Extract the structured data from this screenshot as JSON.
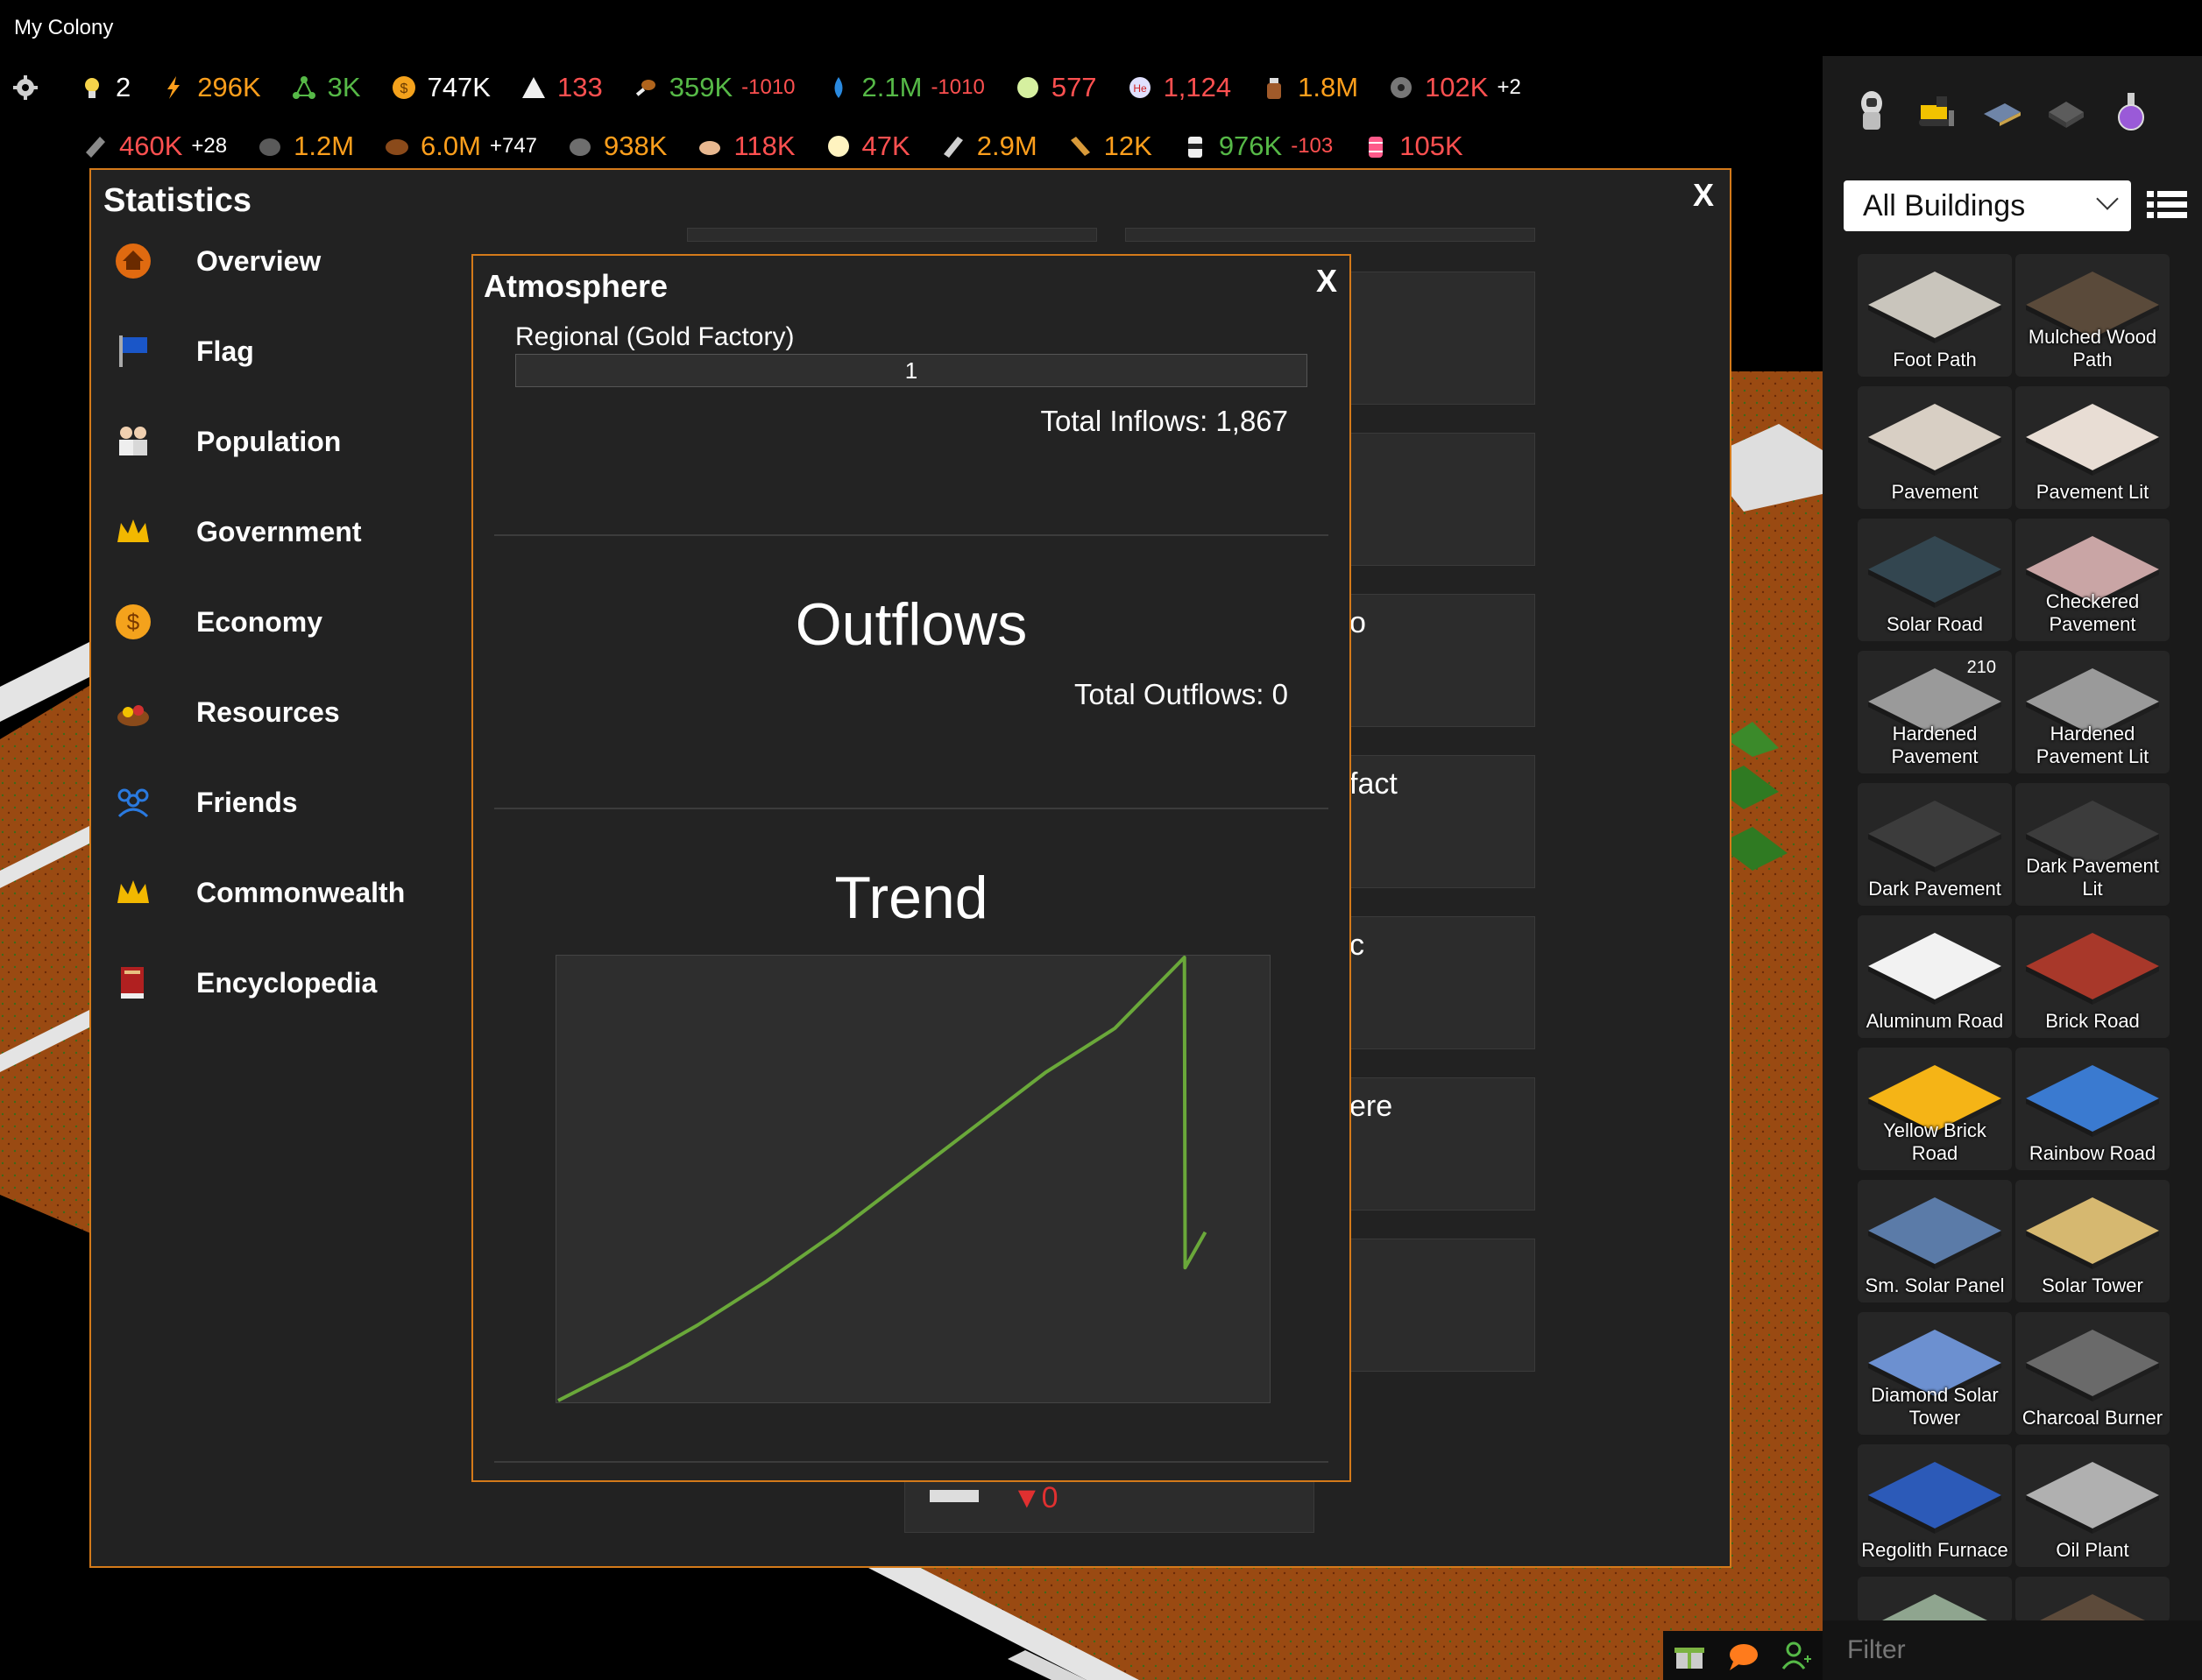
{
  "window_title": "My Colony",
  "resources_row1": [
    {
      "icon": "gear-icon",
      "value": "",
      "delta": "",
      "color": "white"
    },
    {
      "icon": "lightbulb-icon",
      "value": "2",
      "delta": "",
      "color": "white"
    },
    {
      "icon": "lightning-icon",
      "value": "296K",
      "delta": "",
      "color": "orange"
    },
    {
      "icon": "network-icon",
      "value": "3K",
      "delta": "",
      "color": "green"
    },
    {
      "icon": "coin-icon",
      "value": "747K",
      "delta": "",
      "color": "white"
    },
    {
      "icon": "tent-icon",
      "value": "133",
      "delta": "",
      "color": "red"
    },
    {
      "icon": "food-icon",
      "value": "359K",
      "delta": "-1010",
      "color": "green"
    },
    {
      "icon": "water-icon",
      "value": "2.1M",
      "delta": "-1010",
      "color": "green"
    },
    {
      "icon": "oxygen-icon",
      "value": "577",
      "delta": "",
      "color": "red"
    },
    {
      "icon": "helium-icon",
      "value": "1,124",
      "delta": "",
      "color": "red"
    },
    {
      "icon": "liquor-icon",
      "value": "1.8M",
      "delta": "",
      "color": "orange"
    },
    {
      "icon": "disc-icon",
      "value": "102K",
      "delta": "+2",
      "color": "red"
    }
  ],
  "resources_row2": [
    {
      "icon": "steel-icon",
      "value": "460K",
      "delta": "+28",
      "color": "red"
    },
    {
      "icon": "regolith-icon",
      "value": "1.2M",
      "delta": "",
      "color": "orange"
    },
    {
      "icon": "wood-icon",
      "value": "6.0M",
      "delta": "+747",
      "color": "orange"
    },
    {
      "icon": "ore-icon",
      "value": "938K",
      "delta": "",
      "color": "orange"
    },
    {
      "icon": "bread-icon",
      "value": "118K",
      "delta": "",
      "color": "red"
    },
    {
      "icon": "popcorn-icon",
      "value": "47K",
      "delta": "",
      "color": "red"
    },
    {
      "icon": "aluminum-icon",
      "value": "2.9M",
      "delta": "",
      "color": "orange"
    },
    {
      "icon": "lumber-icon",
      "value": "12K",
      "delta": "",
      "color": "orange"
    },
    {
      "icon": "canister-icon",
      "value": "976K",
      "delta": "-103",
      "color": "green"
    },
    {
      "icon": "barrel-icon",
      "value": "105K",
      "delta": "",
      "color": "red"
    }
  ],
  "statistics": {
    "title": "Statistics",
    "close": "X",
    "nav": [
      {
        "name": "overview",
        "icon": "home-icon",
        "label": "Overview"
      },
      {
        "name": "flag",
        "icon": "flag-icon",
        "label": "Flag"
      },
      {
        "name": "population",
        "icon": "people-icon",
        "label": "Population"
      },
      {
        "name": "government",
        "icon": "crown-icon",
        "label": "Government"
      },
      {
        "name": "economy",
        "icon": "dollar-icon",
        "label": "Economy"
      },
      {
        "name": "resources",
        "icon": "resources-icon",
        "label": "Resources"
      },
      {
        "name": "friends",
        "icon": "friends-icon",
        "label": "Friends"
      },
      {
        "name": "commonwealth",
        "icon": "crown-icon",
        "label": "Commonwealth"
      },
      {
        "name": "encyclopedia",
        "icon": "book-icon",
        "label": "Encyclopedia"
      }
    ],
    "partial_labels": [
      "o",
      "fact",
      "c",
      "ere"
    ],
    "hidden_delta": "▼0"
  },
  "atmosphere": {
    "title": "Atmosphere",
    "close": "X",
    "regional_label": "Regional (Gold Factory)",
    "regional_value": "1",
    "total_inflows": "Total Inflows: 1,867",
    "outflows_heading": "Outflows",
    "total_outflows": "Total Outflows: 0",
    "trend_heading": "Trend"
  },
  "chart_data": {
    "type": "line",
    "series": [
      {
        "values": [
          0,
          8,
          17,
          27,
          38,
          50,
          62,
          74,
          84,
          100,
          30,
          38
        ]
      }
    ],
    "x": [
      0,
      1,
      2,
      3,
      4,
      5,
      6,
      7,
      8,
      9,
      9.01,
      9.3
    ],
    "color": "#6aa83a",
    "grid": false,
    "xlabel": "",
    "ylabel": ""
  },
  "right_panel": {
    "categories": [
      "astronaut-icon",
      "bulldozer-icon",
      "solar-panel-icon",
      "factory-icon",
      "flask-icon"
    ],
    "dropdown": "All Buildings",
    "filter_placeholder": "Filter",
    "tiles": [
      {
        "label": "Foot Path",
        "badge": "",
        "icon": "footpath-icon",
        "color": "#c9c5bc"
      },
      {
        "label": "Mulched Wood Path",
        "badge": "",
        "icon": "mulch-icon",
        "color": "#5a4a3a"
      },
      {
        "label": "Pavement",
        "badge": "",
        "icon": "pavement-icon",
        "color": "#d8cfc4"
      },
      {
        "label": "Pavement Lit",
        "badge": "",
        "icon": "pavement-lit-icon",
        "color": "#e8ddd4"
      },
      {
        "label": "Solar Road",
        "badge": "",
        "icon": "solar-road-icon",
        "color": "#334650"
      },
      {
        "label": "Checkered Pavement",
        "badge": "",
        "icon": "checkered-icon",
        "color": "#c9a5a5"
      },
      {
        "label": "Hardened Pavement",
        "badge": "210",
        "icon": "hardened-icon",
        "color": "#9a9a9a"
      },
      {
        "label": "Hardened Pavement Lit",
        "badge": "",
        "icon": "hardened-lit-icon",
        "color": "#9a9a9a"
      },
      {
        "label": "Dark Pavement",
        "badge": "",
        "icon": "dark-pavement-icon",
        "color": "#3c3c3c"
      },
      {
        "label": "Dark Pavement Lit",
        "badge": "",
        "icon": "dark-pavement-lit-icon",
        "color": "#3c3c3c"
      },
      {
        "label": "Aluminum Road",
        "badge": "",
        "icon": "aluminum-road-icon",
        "color": "#f2f2f2"
      },
      {
        "label": "Brick Road",
        "badge": "",
        "icon": "brick-road-icon",
        "color": "#a8382a"
      },
      {
        "label": "Yellow Brick Road",
        "badge": "",
        "icon": "yellow-brick-icon",
        "color": "#f5b416"
      },
      {
        "label": "Rainbow Road",
        "badge": "",
        "icon": "rainbow-road-icon",
        "color": "#3a7ad0"
      },
      {
        "label": "Sm. Solar Panel",
        "badge": "",
        "icon": "solar-panel-small-icon",
        "color": "#5b7ba8"
      },
      {
        "label": "Solar Tower",
        "badge": "",
        "icon": "solar-tower-icon",
        "color": "#d6b870"
      },
      {
        "label": "Diamond Solar Tower",
        "badge": "",
        "icon": "diamond-solar-icon",
        "color": "#6c90d0"
      },
      {
        "label": "Charcoal Burner",
        "badge": "",
        "icon": "charcoal-burner-icon",
        "color": "#6a6a6a"
      },
      {
        "label": "Regolith Furnace",
        "badge": "",
        "icon": "regolith-furnace-icon",
        "color": "#2c5ab8"
      },
      {
        "label": "Oil Plant",
        "badge": "",
        "icon": "oil-plant-icon",
        "color": "#b0b0b0"
      },
      {
        "label": "",
        "badge": "",
        "icon": "partial-tile-icon",
        "color": "#8fa58f"
      },
      {
        "label": "",
        "badge": "",
        "icon": "partial-tile-icon",
        "color": "#5c4a3a"
      }
    ]
  }
}
